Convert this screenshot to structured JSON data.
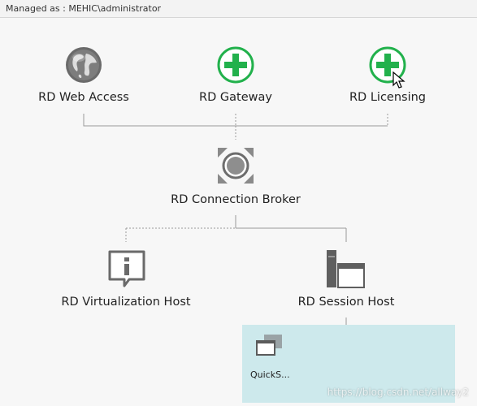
{
  "header": {
    "managed_as": "Managed as : MEHIC\\administrator"
  },
  "nodes": {
    "web_access": "RD Web Access",
    "gateway": "RD Gateway",
    "licensing": "RD Licensing",
    "connection_broker": "RD Connection Broker",
    "virtualization_host": "RD Virtualization Host",
    "session_host": "RD Session Host"
  },
  "collections": {
    "tiles": [
      {
        "label": "QuickS...",
        "icon": "session-collection-icon"
      }
    ]
  },
  "watermark": "https://blog.csdn.net/allway2",
  "colors": {
    "add_green": "#22b14c",
    "panel": "#cde9ec",
    "line": "#9a9a9a"
  }
}
